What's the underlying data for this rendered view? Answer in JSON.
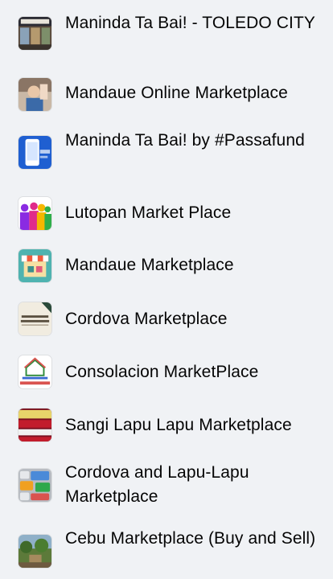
{
  "groups": [
    {
      "name": "Maninda Ta Bai! - TOLEDO CITY",
      "icon": "toledo-city-storefront-thumbnail"
    },
    {
      "name": "Mandaue Online Marketplace",
      "icon": "person-selfie-thumbnail"
    },
    {
      "name": "Maninda Ta Bai! by #Passafund",
      "icon": "phone-app-thumbnail"
    },
    {
      "name": "Lutopan Market Place",
      "icon": "colorful-people-silhouettes-thumbnail"
    },
    {
      "name": "Mandaue Marketplace",
      "icon": "market-stall-thumbnail"
    },
    {
      "name": "Cordova Marketplace",
      "icon": "cordova-text-logo-thumbnail"
    },
    {
      "name": "Consolacion MarketPlace",
      "icon": "house-logo-thumbnail"
    },
    {
      "name": "Sangi Lapu Lapu Marketplace",
      "icon": "red-banner-thumbnail"
    },
    {
      "name": "Cordova and Lapu-Lapu Marketplace",
      "icon": "keyboard-trade-buy-sell-thumbnail"
    },
    {
      "name": "Cebu Marketplace (Buy and Sell)",
      "icon": "outdoor-scene-thumbnail"
    }
  ]
}
